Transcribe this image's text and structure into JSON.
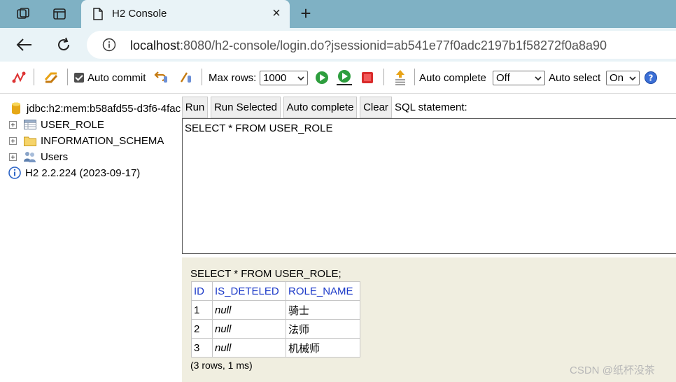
{
  "browser": {
    "tab_title": "H2 Console",
    "url_host": "localhost",
    "url_rest": ":8080/h2-console/login.do?jsessionid=ab541e77f0adc2197b1f58272f0a8a90"
  },
  "toolbar": {
    "auto_commit_label": "Auto commit",
    "auto_commit_checked": true,
    "max_rows_label": "Max rows:",
    "max_rows_value": "1000",
    "auto_complete_label": "Auto complete",
    "auto_complete_value": "Off",
    "auto_select_label": "Auto select",
    "auto_select_value": "On"
  },
  "tree": {
    "connection": "jdbc:h2:mem:b58afd55-d3f6-4fac",
    "items": [
      {
        "label": "USER_ROLE",
        "icon": "table-icon"
      },
      {
        "label": "INFORMATION_SCHEMA",
        "icon": "folder-icon"
      },
      {
        "label": "Users",
        "icon": "users-icon"
      }
    ],
    "version": "H2 2.2.224 (2023-09-17)"
  },
  "query": {
    "buttons": [
      "Run",
      "Run Selected",
      "Auto complete",
      "Clear"
    ],
    "sql_label": "SQL statement:",
    "sql_text": "SELECT * FROM USER_ROLE"
  },
  "result": {
    "sql": "SELECT * FROM USER_ROLE;",
    "columns": [
      "ID",
      "IS_DETELED",
      "ROLE_NAME"
    ],
    "rows": [
      [
        "1",
        "null",
        "骑士"
      ],
      [
        "2",
        "null",
        "法师"
      ],
      [
        "3",
        "null",
        "机械师"
      ]
    ],
    "footer": "(3 rows, 1 ms)"
  },
  "watermark": "CSDN @纸杯没茶",
  "colors": {
    "tabstrip": "#7fb1c4",
    "chrome_bg": "#e9f3f7",
    "result_bg": "#f0eee0",
    "header_text": "#1b39c8"
  }
}
